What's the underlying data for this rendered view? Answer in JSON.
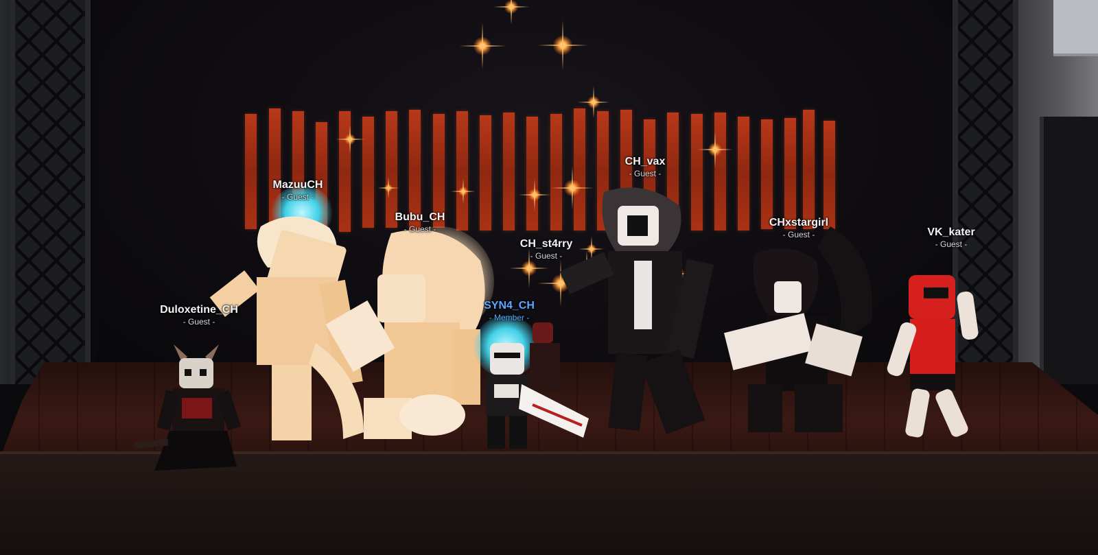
{
  "players": [
    {
      "id": "duloxetine",
      "name": "Duloxetine_CH",
      "role": "- Guest -"
    },
    {
      "id": "mazuu",
      "name": "MazuuCH",
      "role": "- Guest -"
    },
    {
      "id": "bubu",
      "name": "Bubu_CH",
      "role": "- Guest -"
    },
    {
      "id": "st4rry",
      "name": "CH_st4rry",
      "role": "- Guest -"
    },
    {
      "id": "syn4",
      "name": "SYN4_CH",
      "role": "- Member -"
    },
    {
      "id": "vax",
      "name": "CH_vax",
      "role": "- Guest -"
    },
    {
      "id": "stargirl",
      "name": "CHxstargirl",
      "role": "- Guest -"
    },
    {
      "id": "kater",
      "name": "VK_kater",
      "role": "- Guest -"
    }
  ],
  "colors": {
    "name_text": "#f4f4f6",
    "guest_text": "#d8d8dc",
    "member_text": "#5aa7ff",
    "backdrop_bars": "#a93215",
    "stage_floor": "#3a1913"
  }
}
